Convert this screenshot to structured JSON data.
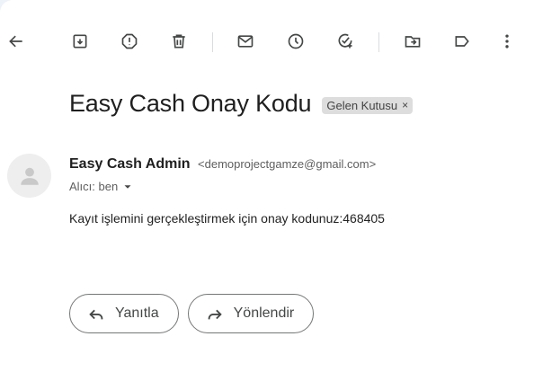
{
  "toolbar": {
    "icons": [
      "back-arrow-icon",
      "archive-icon",
      "report-spam-icon",
      "delete-icon",
      "mark-unread-icon",
      "snooze-icon",
      "add-to-tasks-icon",
      "move-to-icon",
      "label-icon",
      "more-options-icon"
    ]
  },
  "email": {
    "subject": "Easy Cash Onay Kodu",
    "label": "Gelen Kutusu",
    "label_close": "×",
    "sender_name": "Easy Cash Admin",
    "sender_email": "<demoprojectgamze@gmail.com>",
    "to": "Alıcı: ben",
    "body": "Kayıt işlemini gerçekleştirmek için onay kodunuz:468405"
  },
  "actions": {
    "reply": "Yanıtla",
    "forward": "Yönlendir"
  }
}
